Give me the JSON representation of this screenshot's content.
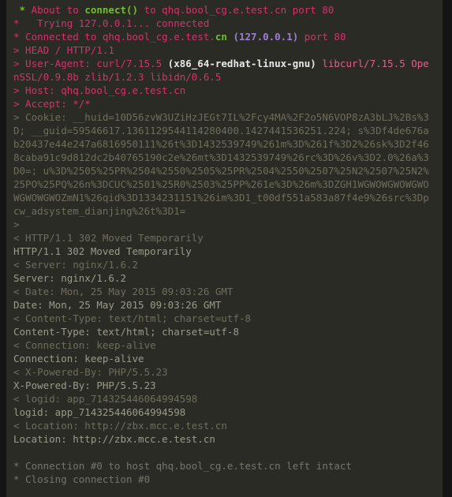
{
  "terminal": {
    "background_color": "#2b2b26",
    "page_background_color": "#141414",
    "colors": {
      "request_magenta": "#d2336b",
      "request_magenta_light": "#e0608f",
      "green": "#6fbf2a",
      "purple": "#9b7fd4",
      "white_bold": "#e8e8e8",
      "dim_olive": "#6e6d5c",
      "response_grey": "#9a9a8c",
      "note_grey": "#76756a"
    },
    "host": "qhq.bool_cg.e.test.cn",
    "ip": "127.0.0.1",
    "port": "80",
    "status_line": "HTTP/1.1 302 Moved Temporarily"
  },
  "lines": [
    {
      "id": "about-to-connect",
      "role": "info",
      "parts": [
        {
          "text": " ",
          "style": "c-req"
        },
        {
          "text": "*",
          "style": "c-green-b"
        },
        {
          "text": " About to ",
          "style": "c-req"
        },
        {
          "text": "connect()",
          "style": "c-green-b"
        },
        {
          "text": " to qhq.bool_cg.e.test.cn port 80",
          "style": "c-req"
        }
      ]
    },
    {
      "id": "trying",
      "role": "info",
      "parts": [
        {
          "text": "*   Trying 127.0.0.1... connected",
          "style": "c-req"
        }
      ]
    },
    {
      "id": "connected",
      "role": "info",
      "parts": [
        {
          "text": "* Connected to qhq.bool_cg.e.test.",
          "style": "c-req"
        },
        {
          "text": "cn",
          "style": "c-green-b"
        },
        {
          "text": " ",
          "style": "c-req"
        },
        {
          "text": "(127.0.0.1)",
          "style": "c-purple"
        },
        {
          "text": " port 80",
          "style": "c-req"
        }
      ]
    },
    {
      "id": "req-head",
      "role": "request",
      "parts": [
        {
          "text": "> HEAD / HTTP/1.1",
          "style": "c-req"
        }
      ]
    },
    {
      "id": "req-user-agent-1",
      "role": "request",
      "parts": [
        {
          "text": "> User-Agent: curl/7.15.5 ",
          "style": "c-req"
        },
        {
          "text": "(x86_64-redhat-linux-gnu)",
          "style": "c-white-b"
        },
        {
          "text": " ",
          "style": "c-req"
        },
        {
          "text": "libcurl/7.15.5 Ope",
          "style": "c-req-lite"
        }
      ]
    },
    {
      "id": "req-user-agent-2",
      "role": "request",
      "parts": [
        {
          "text": "nSSL/0.9.8b zlib/1.2.3 libidn/0.6.5",
          "style": "c-req"
        }
      ]
    },
    {
      "id": "req-host",
      "role": "request",
      "parts": [
        {
          "text": "> Host: qhq.bool_cg.e.test.cn",
          "style": "c-req"
        }
      ]
    },
    {
      "id": "req-accept",
      "role": "request",
      "parts": [
        {
          "text": "> Accept: */*",
          "style": "c-req"
        }
      ]
    },
    {
      "id": "req-cookie-1",
      "role": "request-cookie",
      "parts": [
        {
          "text": "> Cookie: __huid=10D56zvW3UZiHzJEGt7IL%2Fcy4MA%2F2o5N6VOP8zA3bLJ%2Bs%3",
          "style": "c-dim"
        }
      ]
    },
    {
      "id": "req-cookie-2",
      "role": "request-cookie",
      "parts": [
        {
          "text": "D; __guid=59546617.1361129544114280400.1427441536251.224; s%3Df4de676a",
          "style": "c-dim"
        }
      ]
    },
    {
      "id": "req-cookie-3",
      "role": "request-cookie",
      "parts": [
        {
          "text": "b20437e44e247a6816950111%26t%3D1432539749%261m%3D%261f%3D2%26sk%3D2f46",
          "style": "c-dim"
        }
      ]
    },
    {
      "id": "req-cookie-4",
      "role": "request-cookie",
      "parts": [
        {
          "text": "8caba91c9d812dc2b40765190c2e%26mt%3D1432539749%26rc%3D%26v%3D2.0%26a%3",
          "style": "c-dim"
        }
      ]
    },
    {
      "id": "req-cookie-5",
      "role": "request-cookie",
      "parts": [
        {
          "text": "D0=; u%3D%2505%25PR%2504%2550%2505%25PR%2504%2550%2507%25N2%2507%25N2%",
          "style": "c-dim"
        }
      ]
    },
    {
      "id": "req-cookie-6",
      "role": "request-cookie",
      "parts": [
        {
          "text": "25PO%25PQ%26n%3DCUC%2501%25R0%2503%25PP%261e%3D%26m%3DZGH1WGWOWGWOWGWO",
          "style": "c-dim"
        }
      ]
    },
    {
      "id": "req-cookie-7",
      "role": "request-cookie",
      "parts": [
        {
          "text": "WGWOWGWOZmN1%26qid%3D1334231151%26im%3D1_t00df551a583a87f4e9%26src%3Dp",
          "style": "c-dim"
        }
      ]
    },
    {
      "id": "req-cookie-8",
      "role": "request-cookie",
      "parts": [
        {
          "text": "cw_adsystem_dianjing%26t%3D1=",
          "style": "c-dim"
        }
      ]
    },
    {
      "id": "req-end",
      "role": "request",
      "parts": [
        {
          "text": ">",
          "style": "c-dim"
        }
      ]
    },
    {
      "id": "resp-status-marked",
      "role": "response-marked",
      "parts": [
        {
          "text": "< HTTP/1.1 302 Moved Temporarily",
          "style": "c-dim"
        }
      ]
    },
    {
      "id": "resp-status-echo",
      "role": "response-echo",
      "parts": [
        {
          "text": "HTTP/1.1 302 Moved Temporarily",
          "style": "c-resp"
        }
      ]
    },
    {
      "id": "resp-server-marked",
      "role": "response-marked",
      "parts": [
        {
          "text": "< Server: nginx/1.6.2",
          "style": "c-dim"
        }
      ]
    },
    {
      "id": "resp-server-echo",
      "role": "response-echo",
      "parts": [
        {
          "text": "Server: nginx/1.6.2",
          "style": "c-resp"
        }
      ]
    },
    {
      "id": "resp-date-marked",
      "role": "response-marked",
      "parts": [
        {
          "text": "< Date: Mon, 25 May 2015 09:03:26 GMT",
          "style": "c-dim"
        }
      ]
    },
    {
      "id": "resp-date-echo",
      "role": "response-echo",
      "parts": [
        {
          "text": "Date: Mon, 25 May 2015 09:03:26 GMT",
          "style": "c-resp"
        }
      ]
    },
    {
      "id": "resp-ctype-marked",
      "role": "response-marked",
      "parts": [
        {
          "text": "< Content-Type: text/html; charset=utf-8",
          "style": "c-dim"
        }
      ]
    },
    {
      "id": "resp-ctype-echo",
      "role": "response-echo",
      "parts": [
        {
          "text": "Content-Type: text/html; charset=utf-8",
          "style": "c-resp"
        }
      ]
    },
    {
      "id": "resp-conn-marked",
      "role": "response-marked",
      "parts": [
        {
          "text": "< Connection: keep-alive",
          "style": "c-dim"
        }
      ]
    },
    {
      "id": "resp-conn-echo",
      "role": "response-echo",
      "parts": [
        {
          "text": "Connection: keep-alive",
          "style": "c-resp"
        }
      ]
    },
    {
      "id": "resp-xpb-marked",
      "role": "response-marked",
      "parts": [
        {
          "text": "< X-Powered-By: PHP/5.5.23",
          "style": "c-dim"
        }
      ]
    },
    {
      "id": "resp-xpb-echo",
      "role": "response-echo",
      "parts": [
        {
          "text": "X-Powered-By: PHP/5.5.23",
          "style": "c-resp"
        }
      ]
    },
    {
      "id": "resp-logid-marked",
      "role": "response-marked",
      "parts": [
        {
          "text": "< logid: app_714325446064994598",
          "style": "c-dim"
        }
      ]
    },
    {
      "id": "resp-logid-echo",
      "role": "response-echo",
      "parts": [
        {
          "text": "logid: app_714325446064994598",
          "style": "c-resp"
        }
      ]
    },
    {
      "id": "resp-location-marked",
      "role": "response-marked",
      "parts": [
        {
          "text": "< Location: http://zbx.mcc.e.test.cn",
          "style": "c-dim"
        }
      ]
    },
    {
      "id": "resp-location-echo",
      "role": "response-echo",
      "parts": [
        {
          "text": "Location: http://zbx.mcc.e.test.cn",
          "style": "c-resp"
        }
      ]
    },
    {
      "id": "spacer-1",
      "role": "blank",
      "parts": []
    },
    {
      "id": "note-left-intact",
      "role": "note",
      "parts": [
        {
          "text": "* Connection #0 to host qhq.bool_cg.e.test.cn left intact",
          "style": "c-note"
        }
      ]
    },
    {
      "id": "note-closing",
      "role": "note",
      "parts": [
        {
          "text": "* Closing connection #0",
          "style": "c-note"
        }
      ]
    }
  ]
}
